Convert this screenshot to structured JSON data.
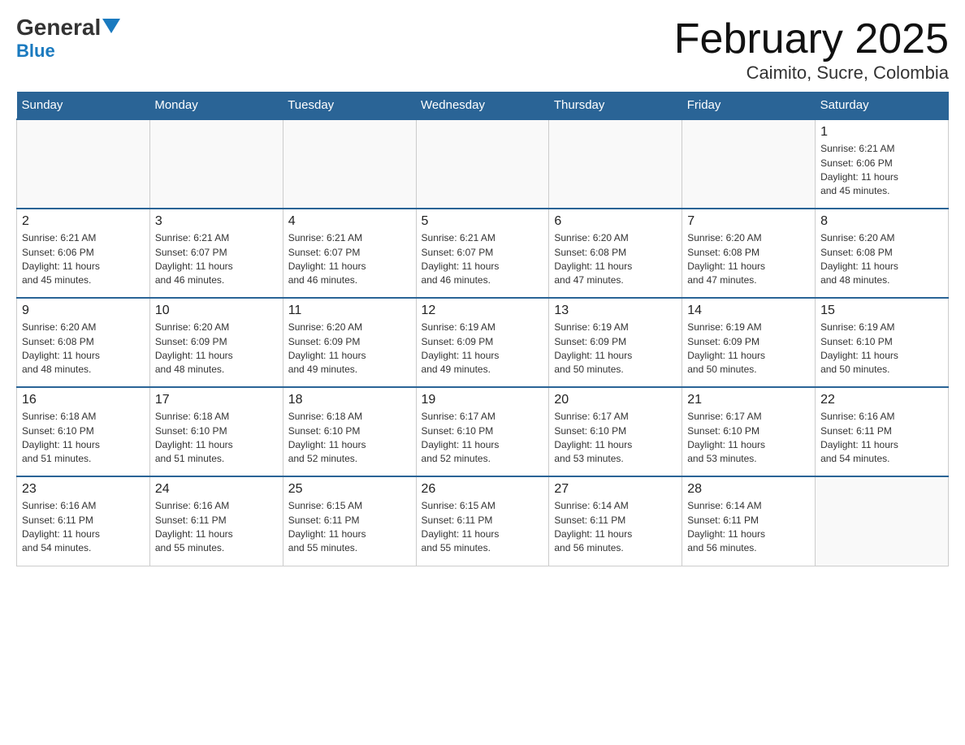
{
  "logo": {
    "part1": "General",
    "part2": "Blue"
  },
  "title": "February 2025",
  "subtitle": "Caimito, Sucre, Colombia",
  "days_of_week": [
    "Sunday",
    "Monday",
    "Tuesday",
    "Wednesday",
    "Thursday",
    "Friday",
    "Saturday"
  ],
  "weeks": [
    [
      {
        "day": "",
        "info": ""
      },
      {
        "day": "",
        "info": ""
      },
      {
        "day": "",
        "info": ""
      },
      {
        "day": "",
        "info": ""
      },
      {
        "day": "",
        "info": ""
      },
      {
        "day": "",
        "info": ""
      },
      {
        "day": "1",
        "info": "Sunrise: 6:21 AM\nSunset: 6:06 PM\nDaylight: 11 hours\nand 45 minutes."
      }
    ],
    [
      {
        "day": "2",
        "info": "Sunrise: 6:21 AM\nSunset: 6:06 PM\nDaylight: 11 hours\nand 45 minutes."
      },
      {
        "day": "3",
        "info": "Sunrise: 6:21 AM\nSunset: 6:07 PM\nDaylight: 11 hours\nand 46 minutes."
      },
      {
        "day": "4",
        "info": "Sunrise: 6:21 AM\nSunset: 6:07 PM\nDaylight: 11 hours\nand 46 minutes."
      },
      {
        "day": "5",
        "info": "Sunrise: 6:21 AM\nSunset: 6:07 PM\nDaylight: 11 hours\nand 46 minutes."
      },
      {
        "day": "6",
        "info": "Sunrise: 6:20 AM\nSunset: 6:08 PM\nDaylight: 11 hours\nand 47 minutes."
      },
      {
        "day": "7",
        "info": "Sunrise: 6:20 AM\nSunset: 6:08 PM\nDaylight: 11 hours\nand 47 minutes."
      },
      {
        "day": "8",
        "info": "Sunrise: 6:20 AM\nSunset: 6:08 PM\nDaylight: 11 hours\nand 48 minutes."
      }
    ],
    [
      {
        "day": "9",
        "info": "Sunrise: 6:20 AM\nSunset: 6:08 PM\nDaylight: 11 hours\nand 48 minutes."
      },
      {
        "day": "10",
        "info": "Sunrise: 6:20 AM\nSunset: 6:09 PM\nDaylight: 11 hours\nand 48 minutes."
      },
      {
        "day": "11",
        "info": "Sunrise: 6:20 AM\nSunset: 6:09 PM\nDaylight: 11 hours\nand 49 minutes."
      },
      {
        "day": "12",
        "info": "Sunrise: 6:19 AM\nSunset: 6:09 PM\nDaylight: 11 hours\nand 49 minutes."
      },
      {
        "day": "13",
        "info": "Sunrise: 6:19 AM\nSunset: 6:09 PM\nDaylight: 11 hours\nand 50 minutes."
      },
      {
        "day": "14",
        "info": "Sunrise: 6:19 AM\nSunset: 6:09 PM\nDaylight: 11 hours\nand 50 minutes."
      },
      {
        "day": "15",
        "info": "Sunrise: 6:19 AM\nSunset: 6:10 PM\nDaylight: 11 hours\nand 50 minutes."
      }
    ],
    [
      {
        "day": "16",
        "info": "Sunrise: 6:18 AM\nSunset: 6:10 PM\nDaylight: 11 hours\nand 51 minutes."
      },
      {
        "day": "17",
        "info": "Sunrise: 6:18 AM\nSunset: 6:10 PM\nDaylight: 11 hours\nand 51 minutes."
      },
      {
        "day": "18",
        "info": "Sunrise: 6:18 AM\nSunset: 6:10 PM\nDaylight: 11 hours\nand 52 minutes."
      },
      {
        "day": "19",
        "info": "Sunrise: 6:17 AM\nSunset: 6:10 PM\nDaylight: 11 hours\nand 52 minutes."
      },
      {
        "day": "20",
        "info": "Sunrise: 6:17 AM\nSunset: 6:10 PM\nDaylight: 11 hours\nand 53 minutes."
      },
      {
        "day": "21",
        "info": "Sunrise: 6:17 AM\nSunset: 6:10 PM\nDaylight: 11 hours\nand 53 minutes."
      },
      {
        "day": "22",
        "info": "Sunrise: 6:16 AM\nSunset: 6:11 PM\nDaylight: 11 hours\nand 54 minutes."
      }
    ],
    [
      {
        "day": "23",
        "info": "Sunrise: 6:16 AM\nSunset: 6:11 PM\nDaylight: 11 hours\nand 54 minutes."
      },
      {
        "day": "24",
        "info": "Sunrise: 6:16 AM\nSunset: 6:11 PM\nDaylight: 11 hours\nand 55 minutes."
      },
      {
        "day": "25",
        "info": "Sunrise: 6:15 AM\nSunset: 6:11 PM\nDaylight: 11 hours\nand 55 minutes."
      },
      {
        "day": "26",
        "info": "Sunrise: 6:15 AM\nSunset: 6:11 PM\nDaylight: 11 hours\nand 55 minutes."
      },
      {
        "day": "27",
        "info": "Sunrise: 6:14 AM\nSunset: 6:11 PM\nDaylight: 11 hours\nand 56 minutes."
      },
      {
        "day": "28",
        "info": "Sunrise: 6:14 AM\nSunset: 6:11 PM\nDaylight: 11 hours\nand 56 minutes."
      },
      {
        "day": "",
        "info": ""
      }
    ]
  ]
}
